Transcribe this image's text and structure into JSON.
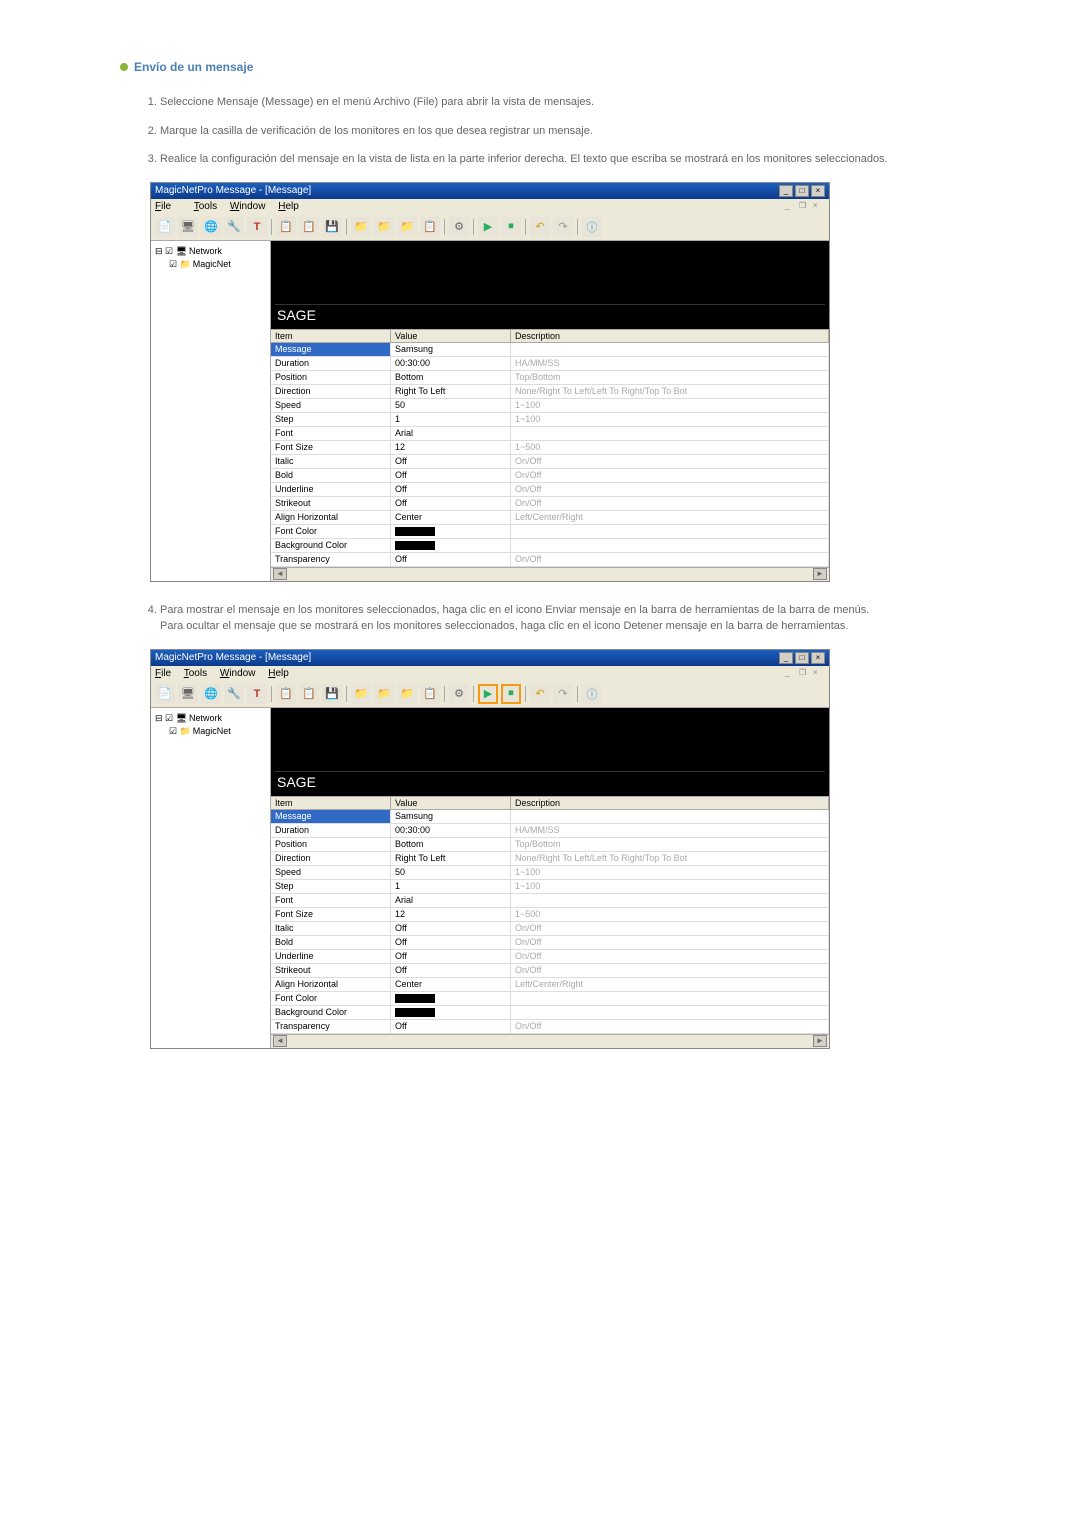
{
  "section": {
    "title": "Envío de un mensaje"
  },
  "steps": {
    "s1": "Seleccione Mensaje (Message) en el menú Archivo (File) para abrir la vista de mensajes.",
    "s2": "Marque la casilla de verificación de los monitores en los que desea registrar un mensaje.",
    "s3": "Realice la configuración del mensaje en la vista de lista en la parte inferior derecha. El texto que escriba se mostrará en los monitores seleccionados.",
    "s4a": "Para mostrar el mensaje en los monitores seleccionados, haga clic en el icono Enviar mensaje en la barra de herramientas de la barra de menús.",
    "s4b": "Para ocultar el mensaje que se mostrará en los monitores seleccionados, haga clic en el icono Detener mensaje en la barra de herramientas."
  },
  "app": {
    "title": "MagicNetPro Message - [Message]",
    "menu": {
      "file": "File",
      "tools": "Tools",
      "window": "Window",
      "help": "Help"
    },
    "tree": {
      "root": "Network",
      "child": "MagicNet"
    },
    "preview_text": "SAGE",
    "props": {
      "headers": {
        "item": "Item",
        "value": "Value",
        "description": "Description"
      },
      "rows": [
        {
          "item": "Message",
          "value": "Samsung",
          "desc": "",
          "selected": true
        },
        {
          "item": "Duration",
          "value": "00:30:00",
          "desc": "HA/MM/SS"
        },
        {
          "item": "Position",
          "value": "Bottom",
          "desc": "Top/Bottom"
        },
        {
          "item": "Direction",
          "value": "Right To Left",
          "desc": "None/Right To Left/Left To Right/Top To Bot"
        },
        {
          "item": "Speed",
          "value": "50",
          "desc": "1~100"
        },
        {
          "item": "Step",
          "value": "1",
          "desc": "1~100"
        },
        {
          "item": "Font",
          "value": "Arial",
          "desc": ""
        },
        {
          "item": "Font Size",
          "value": "12",
          "desc": "1~500"
        },
        {
          "item": "Italic",
          "value": "Off",
          "desc": "On/Off"
        },
        {
          "item": "Bold",
          "value": "Off",
          "desc": "On/Off"
        },
        {
          "item": "Underline",
          "value": "Off",
          "desc": "On/Off"
        },
        {
          "item": "Strikeout",
          "value": "Off",
          "desc": "On/Off"
        },
        {
          "item": "Align Horizontal",
          "value": "Center",
          "desc": "Left/Center/Right"
        },
        {
          "item": "Font Color",
          "value": "",
          "desc": "",
          "swatch": true
        },
        {
          "item": "Background Color",
          "value": "",
          "desc": "",
          "swatch": true
        },
        {
          "item": "Transparency",
          "value": "Off",
          "desc": "On/Off"
        }
      ]
    }
  }
}
